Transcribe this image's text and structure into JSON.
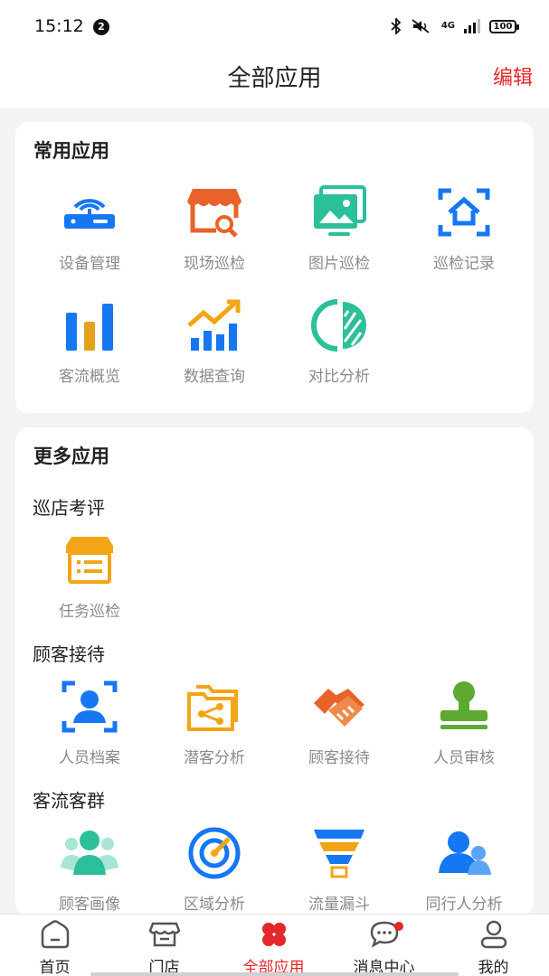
{
  "status_bar": {
    "time": "15:12",
    "notification_count": "2",
    "network": "4G",
    "battery": "100"
  },
  "header": {
    "title": "全部应用",
    "edit_label": "编辑"
  },
  "common_apps": {
    "title": "常用应用",
    "items": [
      {
        "label": "设备管理",
        "icon": "router-icon"
      },
      {
        "label": "现场巡检",
        "icon": "store-inspect-icon"
      },
      {
        "label": "图片巡检",
        "icon": "photo-gallery-icon"
      },
      {
        "label": "巡检记录",
        "icon": "scan-home-icon"
      },
      {
        "label": "客流概览",
        "icon": "bar-chart-icon"
      },
      {
        "label": "数据查询",
        "icon": "trend-chart-icon"
      },
      {
        "label": "对比分析",
        "icon": "half-circle-icon"
      }
    ]
  },
  "more_apps": {
    "title": "更多应用",
    "groups": [
      {
        "title": "巡店考评",
        "items": [
          {
            "label": "任务巡检",
            "icon": "task-box-icon"
          }
        ]
      },
      {
        "title": "顾客接待",
        "items": [
          {
            "label": "人员档案",
            "icon": "person-scan-icon"
          },
          {
            "label": "潜客分析",
            "icon": "share-folder-icon"
          },
          {
            "label": "顾客接待",
            "icon": "handshake-icon"
          },
          {
            "label": "人员审核",
            "icon": "stamp-icon"
          }
        ]
      },
      {
        "title": "客流客群",
        "items": [
          {
            "label": "顾客画像",
            "icon": "people-group-icon"
          },
          {
            "label": "区域分析",
            "icon": "radar-icon"
          },
          {
            "label": "流量漏斗",
            "icon": "funnel-icon"
          },
          {
            "label": "同行人分析",
            "icon": "companion-icon"
          }
        ]
      }
    ]
  },
  "tab_bar": [
    {
      "label": "首页",
      "icon": "home-icon"
    },
    {
      "label": "门店",
      "icon": "store-icon"
    },
    {
      "label": "全部应用",
      "icon": "apps-icon",
      "active": true
    },
    {
      "label": "消息中心",
      "icon": "message-icon",
      "has_dot": true
    },
    {
      "label": "我的",
      "icon": "profile-icon"
    }
  ],
  "colors": {
    "accent": "#e5262b",
    "blue": "#1677f2",
    "orange": "#e8622a",
    "teal": "#2bbf9a",
    "amber": "#f2a516",
    "green": "#5fa832"
  }
}
